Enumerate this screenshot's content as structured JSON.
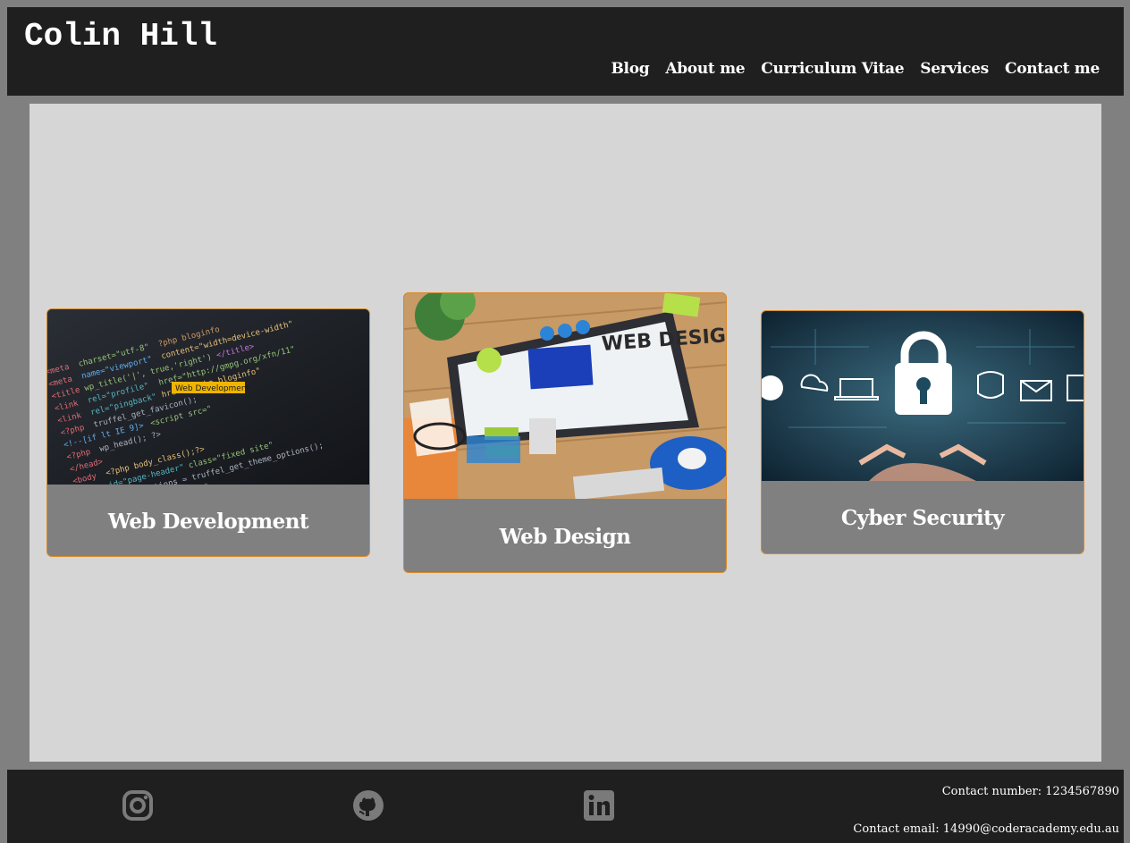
{
  "header": {
    "title": "Colin Hill",
    "nav": [
      "Blog",
      "About me",
      "Curriculum Vitae",
      "Services",
      "Contact me"
    ]
  },
  "cards": [
    {
      "title": "Web Development",
      "image_label": "Web Development",
      "icon": "code-screen-image"
    },
    {
      "title": "Web Design",
      "image_label": "WEB DESIGN",
      "icon": "web-design-desk-image"
    },
    {
      "title": "Cyber Security",
      "image_label": "",
      "icon": "padlock-security-image"
    }
  ],
  "footer": {
    "social": [
      "instagram-icon",
      "github-icon",
      "linkedin-icon"
    ],
    "contact_number": "Contact number: 1234567890",
    "contact_email": "Contact email: 14990@coderacademy.edu.au"
  },
  "colors": {
    "header_bg": "#1f1f1f",
    "page_bg": "#808080",
    "main_bg": "#d6d6d6",
    "card_bg": "#808080",
    "card_border": "#d98a2b",
    "icon_gray": "#7a7a7a"
  }
}
